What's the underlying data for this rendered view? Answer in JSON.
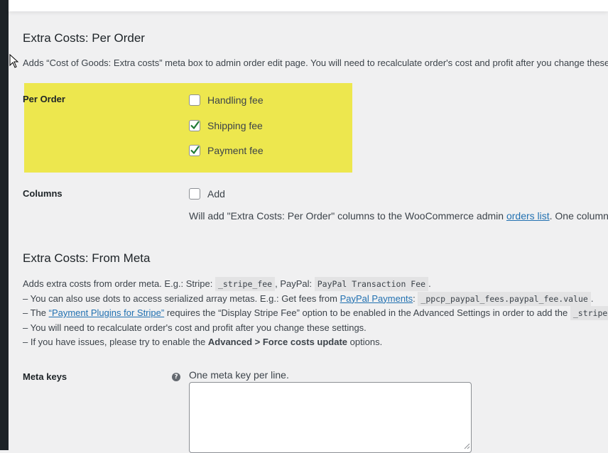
{
  "extra_costs_per_order": {
    "title": "Extra Costs: Per Order",
    "description": "Adds “Cost of Goods: Extra costs” meta box to admin order edit page. You will need to recalculate order's cost and profit after you change these",
    "per_order": {
      "label": "Per Order",
      "options": [
        {
          "label": "Handling fee",
          "checked": false
        },
        {
          "label": "Shipping fee",
          "checked": true
        },
        {
          "label": "Payment fee",
          "checked": true
        }
      ]
    },
    "columns": {
      "label": "Columns",
      "option": {
        "label": "Add",
        "checked": false
      },
      "help_prefix": "Will add \"Extra Costs: Per Order\" columns to the WooCommerce admin ",
      "help_link": "orders list",
      "help_suffix": ". One column"
    }
  },
  "extra_costs_from_meta": {
    "title": "Extra Costs: From Meta",
    "line1": {
      "prefix": "Adds extra costs from order meta. E.g.: Stripe: ",
      "code1": "_stripe_fee",
      "middle": ", PayPal: ",
      "code2": "PayPal Transaction Fee",
      "suffix": "."
    },
    "line2": {
      "prefix": "– You can also use dots to access serialized array metas. E.g.: Get fees from ",
      "link": "PayPal Payments",
      "middle": ": ",
      "code": "_ppcp_paypal_fees.paypal_fee.value",
      "suffix": "."
    },
    "line3": {
      "prefix": "– The ",
      "link": "“Payment Plugins for Stripe”",
      "middle": " requires the “Display Stripe Fee” option to be enabled in the Advanced Settings in order to add the ",
      "code": "_stripe"
    },
    "line4": "– You will need to recalculate order's cost and profit after you change these settings.",
    "line5": {
      "prefix": "– If you have issues, please try to enable the ",
      "bold": "Advanced > Force costs update",
      "suffix": " options."
    },
    "meta_keys": {
      "label": "Meta keys",
      "help_icon": "?",
      "hint": "One meta key per line.",
      "value": ""
    }
  }
}
